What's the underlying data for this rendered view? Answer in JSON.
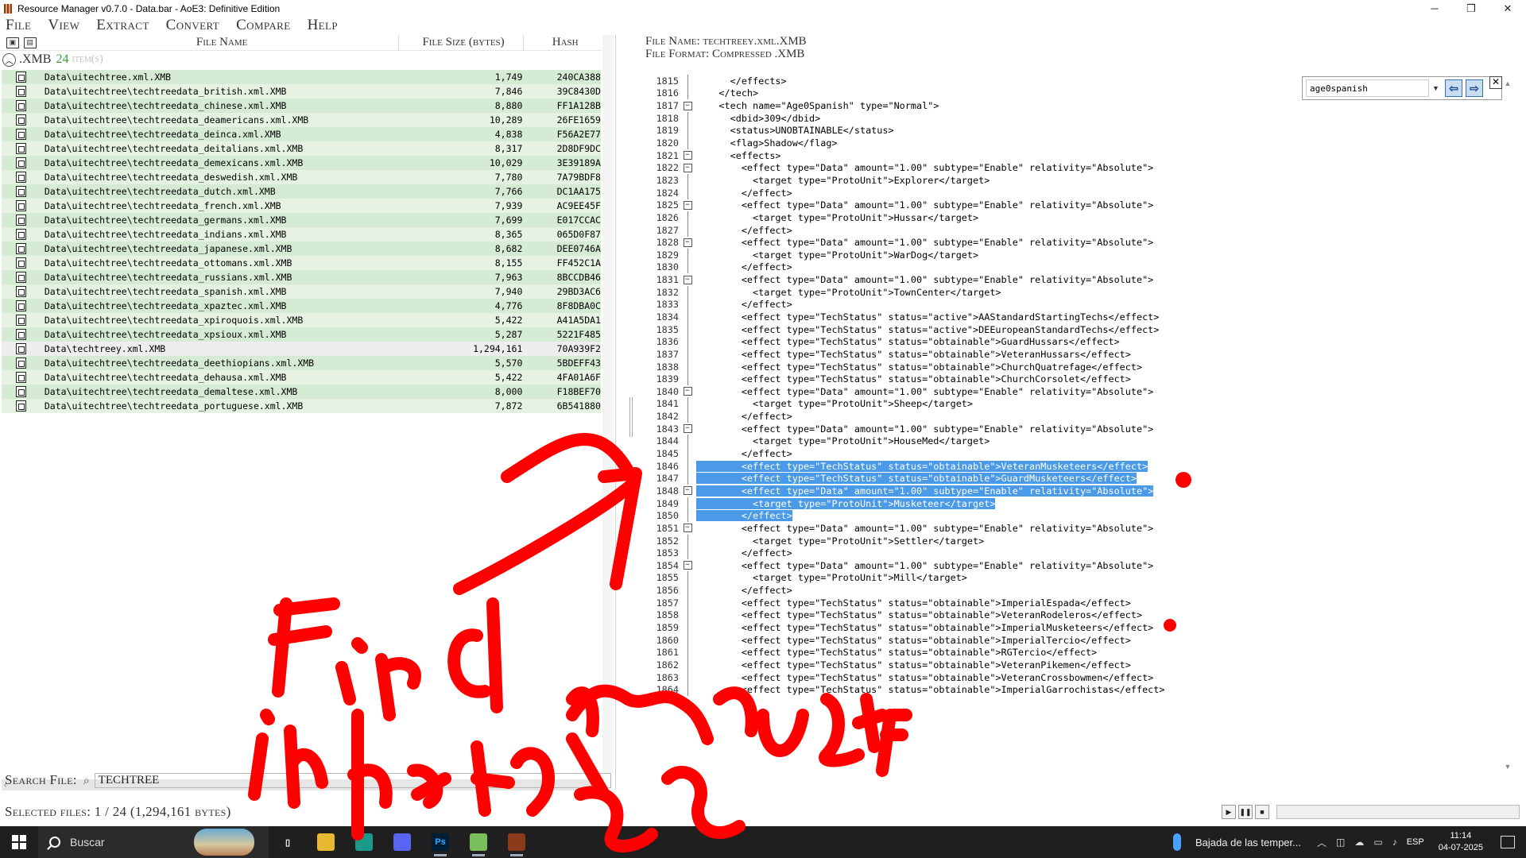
{
  "window": {
    "title": "Resource Manager v0.7.0 - Data.bar - AoE3: Definitive Edition",
    "minimize": "─",
    "maximize": "❐",
    "close": "✕"
  },
  "menu": [
    "File",
    "View",
    "Extract",
    "Convert",
    "Compare",
    "Help"
  ],
  "file_table": {
    "headers": {
      "name": "File Name",
      "size": "File Size (bytes)",
      "hash": "Hash"
    },
    "group": {
      "ext": ".XMB",
      "count": "24",
      "items_label": "item(s)"
    },
    "rows": [
      {
        "name": "Data\\uitechtree.xml.XMB",
        "size": "1,749",
        "hash": "240CA388"
      },
      {
        "name": "Data\\uitechtree\\techtreedata_british.xml.XMB",
        "size": "7,846",
        "hash": "39C8430D"
      },
      {
        "name": "Data\\uitechtree\\techtreedata_chinese.xml.XMB",
        "size": "8,880",
        "hash": "FF1A128B"
      },
      {
        "name": "Data\\uitechtree\\techtreedata_deamericans.xml.XMB",
        "size": "10,289",
        "hash": "26FE1659"
      },
      {
        "name": "Data\\uitechtree\\techtreedata_deinca.xml.XMB",
        "size": "4,838",
        "hash": "F56A2E77"
      },
      {
        "name": "Data\\uitechtree\\techtreedata_deitalians.xml.XMB",
        "size": "8,317",
        "hash": "2D8DF9DC"
      },
      {
        "name": "Data\\uitechtree\\techtreedata_demexicans.xml.XMB",
        "size": "10,029",
        "hash": "3E39189A"
      },
      {
        "name": "Data\\uitechtree\\techtreedata_deswedish.xml.XMB",
        "size": "7,780",
        "hash": "7A79BDF8"
      },
      {
        "name": "Data\\uitechtree\\techtreedata_dutch.xml.XMB",
        "size": "7,766",
        "hash": "DC1AA175"
      },
      {
        "name": "Data\\uitechtree\\techtreedata_french.xml.XMB",
        "size": "7,939",
        "hash": "AC9EE45F"
      },
      {
        "name": "Data\\uitechtree\\techtreedata_germans.xml.XMB",
        "size": "7,699",
        "hash": "E017CCAC"
      },
      {
        "name": "Data\\uitechtree\\techtreedata_indians.xml.XMB",
        "size": "8,365",
        "hash": "065D0F87"
      },
      {
        "name": "Data\\uitechtree\\techtreedata_japanese.xml.XMB",
        "size": "8,682",
        "hash": "DEE0746A"
      },
      {
        "name": "Data\\uitechtree\\techtreedata_ottomans.xml.XMB",
        "size": "8,155",
        "hash": "FF452C1A"
      },
      {
        "name": "Data\\uitechtree\\techtreedata_russians.xml.XMB",
        "size": "7,963",
        "hash": "8BCCDB46"
      },
      {
        "name": "Data\\uitechtree\\techtreedata_spanish.xml.XMB",
        "size": "7,940",
        "hash": "29BD3AC6"
      },
      {
        "name": "Data\\uitechtree\\techtreedata_xpaztec.xml.XMB",
        "size": "4,776",
        "hash": "8F8DBA0C"
      },
      {
        "name": "Data\\uitechtree\\techtreedata_xpiroquois.xml.XMB",
        "size": "5,422",
        "hash": "A41A5DA1"
      },
      {
        "name": "Data\\uitechtree\\techtreedata_xpsioux.xml.XMB",
        "size": "5,287",
        "hash": "5221F485"
      },
      {
        "name": "Data\\techtreey.xml.XMB",
        "size": "1,294,161",
        "hash": "70A939F2",
        "selected": true
      },
      {
        "name": "Data\\uitechtree\\techtreedata_deethiopians.xml.XMB",
        "size": "5,570",
        "hash": "5BDEFF43"
      },
      {
        "name": "Data\\uitechtree\\techtreedata_dehausa.xml.XMB",
        "size": "5,422",
        "hash": "4FA01A6F"
      },
      {
        "name": "Data\\uitechtree\\techtreedata_demaltese.xml.XMB",
        "size": "8,000",
        "hash": "F18BEF70"
      },
      {
        "name": "Data\\uitechtree\\techtreedata_portuguese.xml.XMB",
        "size": "7,872",
        "hash": "6B541880"
      }
    ]
  },
  "search": {
    "label": "Search File:",
    "value": "TECHTREE"
  },
  "status": {
    "selected": "Selected files: 1 / 24 (1,294,161 bytes)"
  },
  "viewer": {
    "file_name": "File Name: techtreey.xml.XMB",
    "file_format": "File Format: Compressed .XMB",
    "find": {
      "value": "age0spanish"
    },
    "lines": [
      {
        "n": "1815",
        "fold": "line",
        "code": "      </effects>"
      },
      {
        "n": "1816",
        "fold": "line",
        "code": "    </tech>"
      },
      {
        "n": "1817",
        "fold": "box",
        "code": "    <tech name=\"Age0Spanish\" type=\"Normal\">"
      },
      {
        "n": "1818",
        "fold": "line",
        "code": "      <dbid>309</dbid>"
      },
      {
        "n": "1819",
        "fold": "line",
        "code": "      <status>UNOBTAINABLE</status>"
      },
      {
        "n": "1820",
        "fold": "line",
        "code": "      <flag>Shadow</flag>"
      },
      {
        "n": "1821",
        "fold": "box",
        "code": "      <effects>"
      },
      {
        "n": "1822",
        "fold": "box",
        "code": "        <effect type=\"Data\" amount=\"1.00\" subtype=\"Enable\" relativity=\"Absolute\">"
      },
      {
        "n": "1823",
        "fold": "line",
        "code": "          <target type=\"ProtoUnit\">Explorer</target>"
      },
      {
        "n": "1824",
        "fold": "line",
        "code": "        </effect>"
      },
      {
        "n": "1825",
        "fold": "box",
        "code": "        <effect type=\"Data\" amount=\"1.00\" subtype=\"Enable\" relativity=\"Absolute\">"
      },
      {
        "n": "1826",
        "fold": "line",
        "code": "          <target type=\"ProtoUnit\">Hussar</target>"
      },
      {
        "n": "1827",
        "fold": "line",
        "code": "        </effect>"
      },
      {
        "n": "1828",
        "fold": "box",
        "code": "        <effect type=\"Data\" amount=\"1.00\" subtype=\"Enable\" relativity=\"Absolute\">"
      },
      {
        "n": "1829",
        "fold": "line",
        "code": "          <target type=\"ProtoUnit\">WarDog</target>"
      },
      {
        "n": "1830",
        "fold": "line",
        "code": "        </effect>"
      },
      {
        "n": "1831",
        "fold": "box",
        "code": "        <effect type=\"Data\" amount=\"1.00\" subtype=\"Enable\" relativity=\"Absolute\">"
      },
      {
        "n": "1832",
        "fold": "line",
        "code": "          <target type=\"ProtoUnit\">TownCenter</target>"
      },
      {
        "n": "1833",
        "fold": "line",
        "code": "        </effect>"
      },
      {
        "n": "1834",
        "fold": "line",
        "code": "        <effect type=\"TechStatus\" status=\"active\">AAStandardStartingTechs</effect>"
      },
      {
        "n": "1835",
        "fold": "line",
        "code": "        <effect type=\"TechStatus\" status=\"active\">DEEuropeanStandardTechs</effect>"
      },
      {
        "n": "1836",
        "fold": "line",
        "code": "        <effect type=\"TechStatus\" status=\"obtainable\">GuardHussars</effect>"
      },
      {
        "n": "1837",
        "fold": "line",
        "code": "        <effect type=\"TechStatus\" status=\"obtainable\">VeteranHussars</effect>"
      },
      {
        "n": "1838",
        "fold": "line",
        "code": "        <effect type=\"TechStatus\" status=\"obtainable\">ChurchQuatrefage</effect>"
      },
      {
        "n": "1839",
        "fold": "line",
        "code": "        <effect type=\"TechStatus\" status=\"obtainable\">ChurchCorsolet</effect>"
      },
      {
        "n": "1840",
        "fold": "box",
        "code": "        <effect type=\"Data\" amount=\"1.00\" subtype=\"Enable\" relativity=\"Absolute\">"
      },
      {
        "n": "1841",
        "fold": "line",
        "code": "          <target type=\"ProtoUnit\">Sheep</target>"
      },
      {
        "n": "1842",
        "fold": "line",
        "code": "        </effect>"
      },
      {
        "n": "1843",
        "fold": "box",
        "code": "        <effect type=\"Data\" amount=\"1.00\" subtype=\"Enable\" relativity=\"Absolute\">"
      },
      {
        "n": "1844",
        "fold": "line",
        "code": "          <target type=\"ProtoUnit\">HouseMed</target>"
      },
      {
        "n": "1845",
        "fold": "line",
        "code": "        </effect>"
      },
      {
        "n": "1846",
        "fold": "line",
        "code": "        <effect type=\"TechStatus\" status=\"obtainable\">VeteranMusketeers</effect>",
        "hl": true
      },
      {
        "n": "1847",
        "fold": "line",
        "code": "        <effect type=\"TechStatus\" status=\"obtainable\">GuardMusketeers</effect>",
        "hl": true
      },
      {
        "n": "1848",
        "fold": "box",
        "code": "        <effect type=\"Data\" amount=\"1.00\" subtype=\"Enable\" relativity=\"Absolute\">",
        "hl": true
      },
      {
        "n": "1849",
        "fold": "line",
        "code": "          <target type=\"ProtoUnit\">Musketeer</target>",
        "hl": true
      },
      {
        "n": "1850",
        "fold": "line",
        "code": "        </effect>",
        "hl": true
      },
      {
        "n": "1851",
        "fold": "box",
        "code": "        <effect type=\"Data\" amount=\"1.00\" subtype=\"Enable\" relativity=\"Absolute\">"
      },
      {
        "n": "1852",
        "fold": "line",
        "code": "          <target type=\"ProtoUnit\">Settler</target>"
      },
      {
        "n": "1853",
        "fold": "line",
        "code": "        </effect>"
      },
      {
        "n": "1854",
        "fold": "box",
        "code": "        <effect type=\"Data\" amount=\"1.00\" subtype=\"Enable\" relativity=\"Absolute\">"
      },
      {
        "n": "1855",
        "fold": "line",
        "code": "          <target type=\"ProtoUnit\">Mill</target>"
      },
      {
        "n": "1856",
        "fold": "line",
        "code": "        </effect>"
      },
      {
        "n": "1857",
        "fold": "line",
        "code": "        <effect type=\"TechStatus\" status=\"obtainable\">ImperialEspada</effect>"
      },
      {
        "n": "1858",
        "fold": "line",
        "code": "        <effect type=\"TechStatus\" status=\"obtainable\">VeteranRodeleros</effect>"
      },
      {
        "n": "1859",
        "fold": "line",
        "code": "        <effect type=\"TechStatus\" status=\"obtainable\">ImperialMusketeers</effect>"
      },
      {
        "n": "1860",
        "fold": "line",
        "code": "        <effect type=\"TechStatus\" status=\"obtainable\">ImperialTercio</effect>"
      },
      {
        "n": "1861",
        "fold": "line",
        "code": "        <effect type=\"TechStatus\" status=\"obtainable\">RGTercio</effect>"
      },
      {
        "n": "1862",
        "fold": "line",
        "code": "        <effect type=\"TechStatus\" status=\"obtainable\">VeteranPikemen</effect>"
      },
      {
        "n": "1863",
        "fold": "line",
        "code": "        <effect type=\"TechStatus\" status=\"obtainable\">VeteranCrossbowmen</effect>"
      },
      {
        "n": "1864",
        "fold": "line",
        "code": "        <effect type=\"TechStatus\" status=\"obtainable\">ImperialGarrochistas</effect>"
      }
    ]
  },
  "taskbar": {
    "search_placeholder": "Buscar",
    "weather": "Bajada de las temper...",
    "lang": "ESP",
    "time": "11:14",
    "date": "04-07-2025",
    "icons": [
      {
        "name": "task-view-icon",
        "glyph": "▯",
        "color": "#ffffff",
        "bg": "transparent"
      },
      {
        "name": "file-explorer-icon",
        "glyph": "",
        "color": "#ffffff",
        "bg": "#e8b830"
      },
      {
        "name": "edge-icon",
        "glyph": "",
        "color": "#ffffff",
        "bg": "#1a9a8a"
      },
      {
        "name": "discord-icon",
        "glyph": "",
        "color": "#ffffff",
        "bg": "#5865f2"
      },
      {
        "name": "photoshop-icon",
        "glyph": "Ps",
        "color": "#31a8ff",
        "bg": "#001e36"
      },
      {
        "name": "notepad-icon",
        "glyph": "",
        "color": "#ffffff",
        "bg": "#7ac05a"
      },
      {
        "name": "resource-manager-icon",
        "glyph": "",
        "color": "#ffffff",
        "bg": "#8b3a1a"
      }
    ]
  },
  "annotation": {
    "color": "#ff0000"
  }
}
